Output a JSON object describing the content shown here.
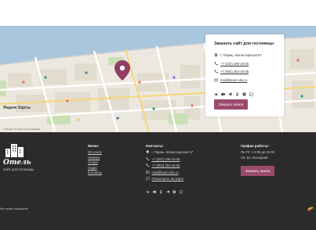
{
  "map": {
    "brand": "Яндекс Карты",
    "attribution": "© Яндекс  Условия использования"
  },
  "contact_card": {
    "title": "Заказать сайт для гостиницы",
    "address": "г. Пермь, Монастырская 57",
    "phone1": "+7 (342) 206-19-35",
    "phone2": "+7 (902) 354-19-35",
    "email": "mail@team-site.ru",
    "socials": [
      "vk-icon",
      "youtube-icon",
      "telegram-icon",
      "odnoklassniki-icon",
      "viber-icon",
      "whatsapp-icon"
    ],
    "button": "Заказать звонок"
  },
  "footer": {
    "logo": {
      "title": "Отель",
      "subtitle": "Сайт для гостиницы"
    },
    "menu": {
      "heading": "Меню:",
      "items": [
        "Об отеле",
        "Номера",
        "Услуги",
        "Акции",
        "Контакты"
      ]
    },
    "contacts": {
      "heading": "Контакты:",
      "address": "г. Пермь, Монастырская 57",
      "phone1": "+7 (342) 206-19-35",
      "phone2": "+7 (902) 354-19-35",
      "email": "mail@team-site.ru",
      "map_link": "Посмотреть на карте"
    },
    "hours": {
      "heading": "График работы:",
      "line1": "Пн-Пт: с 9:00 до 21:00",
      "line2": "Сб, Вс: Выходной",
      "button": "Заказать звонок"
    },
    "copyright": "Все права защищены"
  },
  "colors": {
    "accent": "#9a4a6c",
    "footer_bg": "#2b2b2b",
    "map_bg": "#ede8df",
    "river": "#a9c6dd",
    "marker": "#8f3f63"
  }
}
